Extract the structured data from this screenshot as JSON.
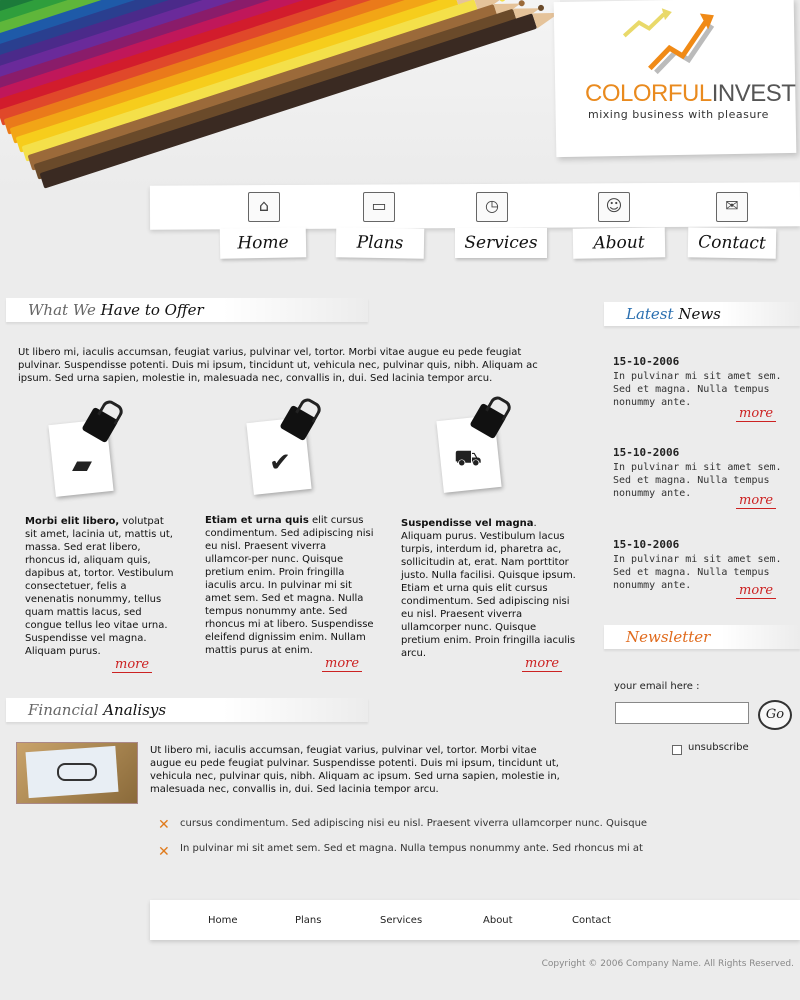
{
  "brand": {
    "name_part1": "COLORFUL",
    "name_part2": "INVEST",
    "tagline": "mixing business with pleasure",
    "accent_color": "#e98a1e"
  },
  "nav": {
    "items": [
      {
        "label": "Home",
        "icon": "house-icon"
      },
      {
        "label": "Plans",
        "icon": "book-icon"
      },
      {
        "label": "Services",
        "icon": "clock-icon"
      },
      {
        "label": "About",
        "icon": "people-icon"
      },
      {
        "label": "Contact",
        "icon": "envelope-icon"
      }
    ]
  },
  "offer": {
    "head_light": "What We",
    "head_dark": "Have to Offer",
    "intro": "Ut libero mi, iaculis accumsan, feugiat varius, pulvinar vel, tortor. Morbi vitae augue eu pede feugiat pulvinar. Suspendisse potenti. Duis mi ipsum, tincidunt ut, vehicula nec, pulvinar quis, nibh. Aliquam ac ipsum. Sed urna sapien, molestie in, malesuada nec, convallis in, dui. Sed lacinia tempor arcu.",
    "columns": [
      {
        "icon": "briefcase-icon",
        "bold": "Morbi elit libero,",
        "text": " volutpat sit amet, lacinia ut, mattis ut, massa. Sed erat libero, rhoncus id, aliquam quis, dapibus at, tortor. Vestibulum consectetuer, felis a venenatis nonummy, tellus quam mattis lacus, sed congue tellus leo vitae urna. Suspendisse vel magna. Aliquam purus.",
        "more": "more"
      },
      {
        "icon": "checkmark-icon",
        "bold": "Etiam et urna quis",
        "text": " elit cursus condimentum. Sed adipiscing nisi eu nisl. Praesent viverra ullamcor-per nunc. Quisque pretium enim. Proin fringilla iaculis arcu. In pulvinar mi sit amet sem. Sed et magna. Nulla tempus nonummy ante. Sed rhoncus mi at libero. Suspendisse eleifend dignissim enim. Nullam mattis purus at enim.",
        "more": "more"
      },
      {
        "icon": "cart-icon",
        "bold": "Suspendisse vel magna",
        "text": ". Aliquam purus. Vestibulum lacus turpis, interdum id, pharetra ac, sollicitudin at, erat. Nam porttitor justo. Nulla facilisi. Quisque ipsum. Etiam et urna quis elit cursus condimentum. Sed adipiscing nisi eu nisl. Praesent viverra ullamcorper nunc. Quisque pretium enim. Proin fringilla iaculis arcu.",
        "more": "more"
      }
    ]
  },
  "news": {
    "head_light": "Latest",
    "head_dark": "News",
    "items": [
      {
        "date": "15-10-2006",
        "text": "In pulvinar mi sit amet sem. Sed et magna. Nulla tempus nonummy ante.",
        "more": "more"
      },
      {
        "date": "15-10-2006",
        "text": "In pulvinar mi sit amet sem. Sed et magna. Nulla tempus nonummy ante.",
        "more": "more"
      },
      {
        "date": "15-10-2006",
        "text": "In pulvinar mi sit amet sem. Sed et magna. Nulla tempus nonummy ante.",
        "more": "more"
      }
    ]
  },
  "newsletter": {
    "head": "Newsletter",
    "email_label": "your email here :",
    "email_value": "",
    "go_label": "Go",
    "unsubscribe_label": "unsubscribe"
  },
  "financial": {
    "head_light": "Financial",
    "head_dark": "Analisys",
    "text": "Ut libero mi, iaculis accumsan, feugiat varius, pulvinar vel, tortor. Morbi vitae augue eu pede feugiat pulvinar. Suspendisse potenti. Duis mi ipsum, tincidunt ut, vehicula nec, pulvinar quis, nibh. Aliquam ac ipsum. Sed urna sapien, molestie in, malesuada nec, convallis in, dui. Sed lacinia tempor arcu.",
    "bullets": [
      "cursus condimentum. Sed adipiscing nisi eu nisl. Praesent viverra ullamcorper nunc. Quisque",
      "In pulvinar mi sit amet sem. Sed et magna. Nulla tempus nonummy ante. Sed rhoncus mi at"
    ],
    "bullet_glyph": "✕"
  },
  "footer": {
    "links": [
      "Home",
      "Plans",
      "Services",
      "About",
      "Contact"
    ],
    "copyright": "Copyright © 2006 Company Name. All Rights Reserved."
  }
}
